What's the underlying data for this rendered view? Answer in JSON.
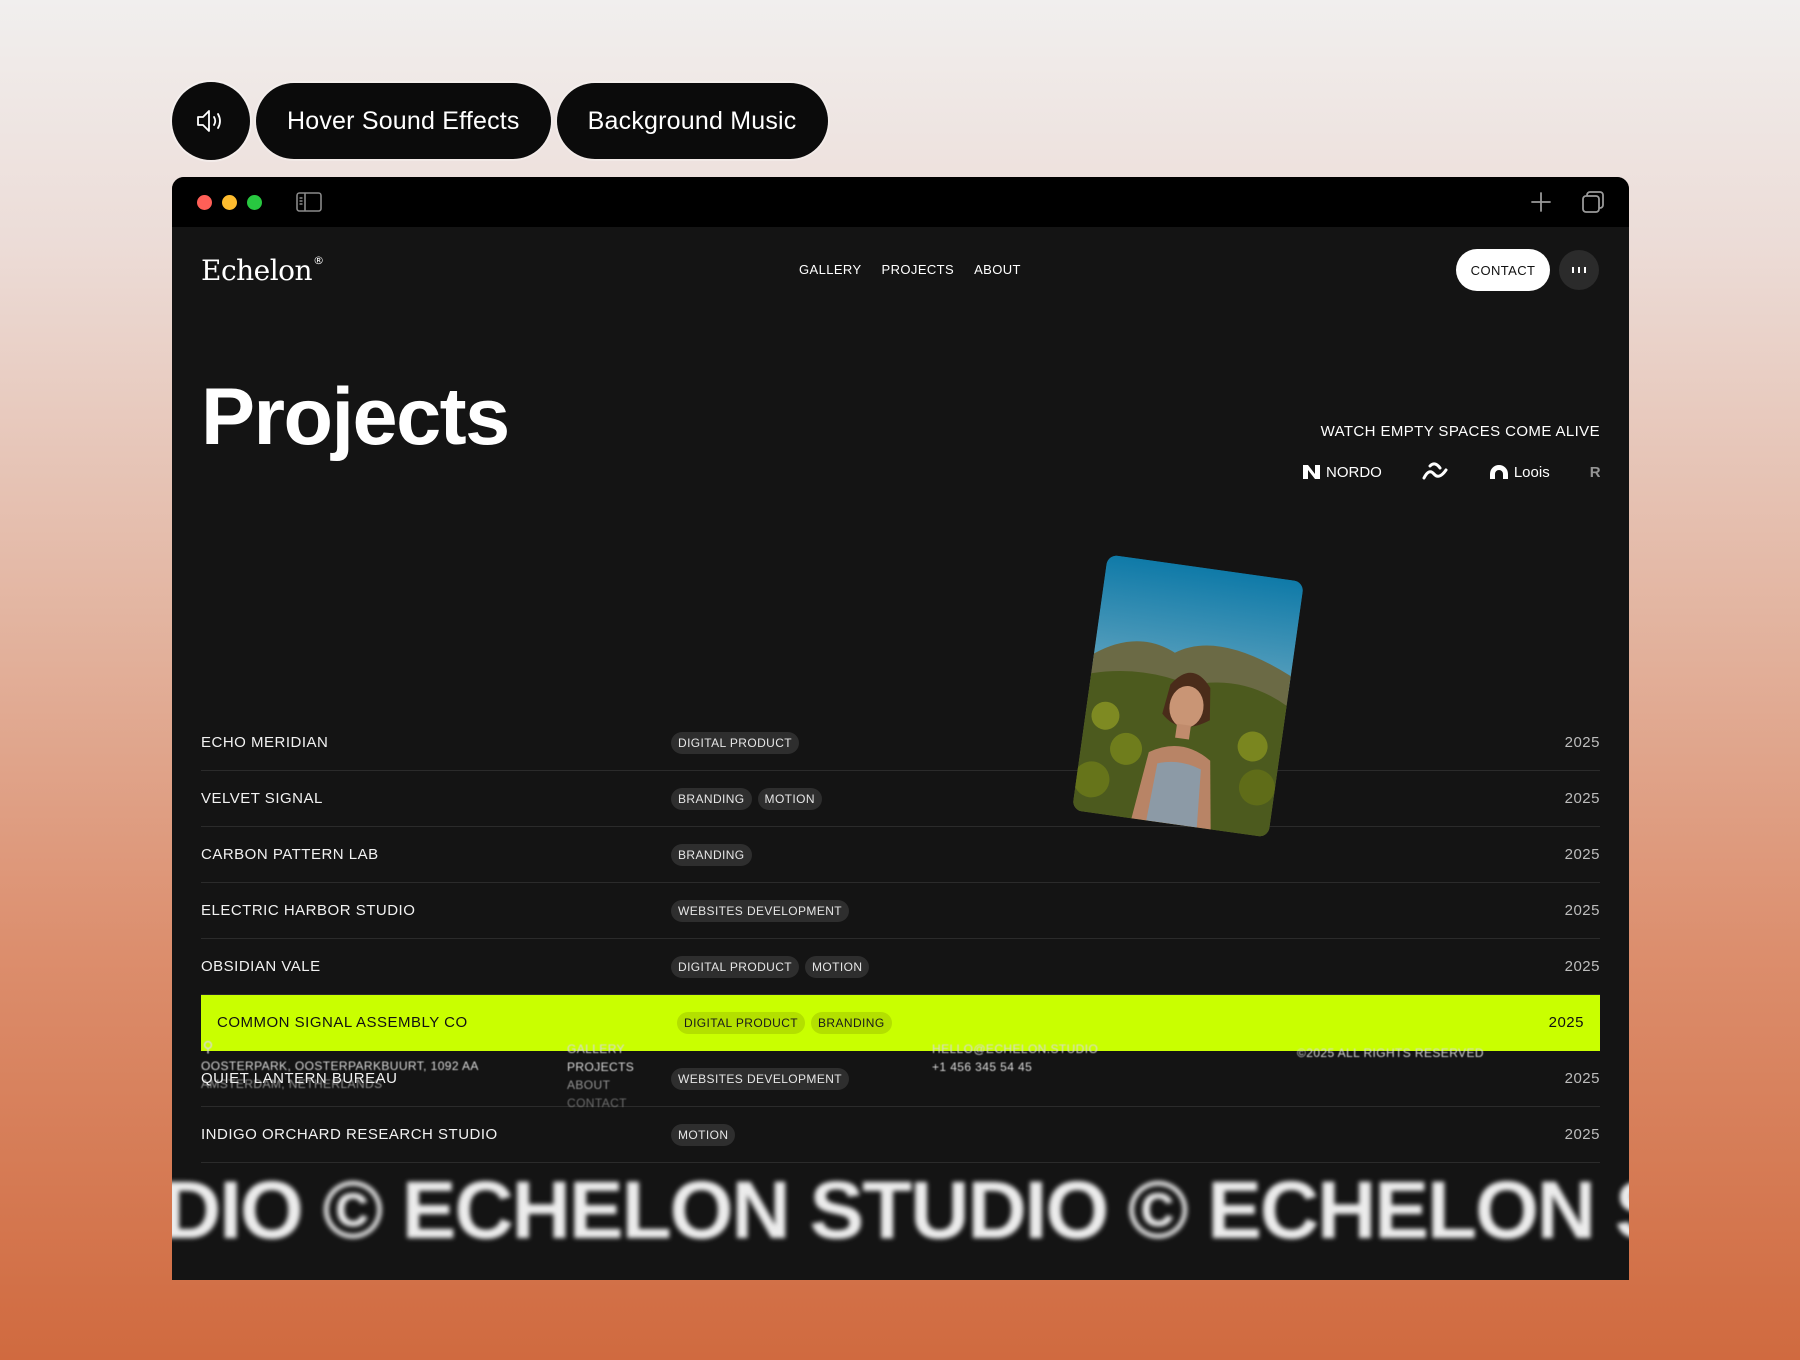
{
  "sound_controls": {
    "icon": "speaker-icon",
    "hover_sound_label": "Hover Sound Effects",
    "background_music_label": "Background Music"
  },
  "browser": {
    "icons": [
      "sidebar-toggle-icon",
      "plus-icon",
      "tabs-overview-icon"
    ]
  },
  "site": {
    "logo": "Echelon",
    "logo_mark": "®",
    "nav": [
      "GALLERY",
      "PROJECTS",
      "ABOUT"
    ],
    "contact_label": "CONTACT"
  },
  "hero": {
    "title": "Projects",
    "tagline": "WATCH EMPTY SPACES COME ALIVE",
    "brands": [
      {
        "name": "NORDO",
        "icon": "nordo-logo-icon"
      },
      {
        "name": "",
        "icon": "wave-logo-icon"
      },
      {
        "name": "Loois",
        "icon": "loois-logo-icon"
      },
      {
        "name": "R",
        "icon": ""
      }
    ]
  },
  "projects": [
    {
      "name": "ECHO MERIDIAN",
      "tags": [
        "DIGITAL PRODUCT"
      ],
      "year": "2025"
    },
    {
      "name": "VELVET SIGNAL",
      "tags": [
        "BRANDING",
        "MOTION"
      ],
      "year": "2025"
    },
    {
      "name": "CARBON PATTERN LAB",
      "tags": [
        "BRANDING"
      ],
      "year": "2025"
    },
    {
      "name": "ELECTRIC HARBOR STUDIO",
      "tags": [
        "WEBSITES DEVELOPMENT"
      ],
      "year": "2025"
    },
    {
      "name": "OBSIDIAN VALE",
      "tags": [
        "DIGITAL PRODUCT",
        "MOTION"
      ],
      "year": "2025"
    },
    {
      "name": "COMMON SIGNAL ASSEMBLY CO",
      "tags": [
        "DIGITAL PRODUCT",
        "BRANDING"
      ],
      "year": "2025",
      "active": true
    },
    {
      "name": "QUIET LANTERN BUREAU",
      "tags": [
        "WEBSITES DEVELOPMENT"
      ],
      "year": "2025"
    },
    {
      "name": "INDIGO ORCHARD RESEARCH STUDIO",
      "tags": [
        "MOTION"
      ],
      "year": "2025"
    }
  ],
  "footer": {
    "address_line1": "OOSTERPARK, OOSTERPARKBUURT, 1092 AA",
    "address_line2": "AMSTERDAM, NETHERLANDS",
    "links": [
      "GALLERY",
      "PROJECTS",
      "ABOUT",
      "CONTACT"
    ],
    "email": "HELLO@ECHELON.STUDIO",
    "phone": "+1 456 345 54 45",
    "copyright": "©2025 ALL RIGHTS RESERVED"
  },
  "marquee": "DIO © ECHELON STUDIO © ECHELON ST",
  "colors": {
    "accent": "#c9ff00",
    "window_bg": "#141414",
    "titlebar_bg": "#000000"
  }
}
